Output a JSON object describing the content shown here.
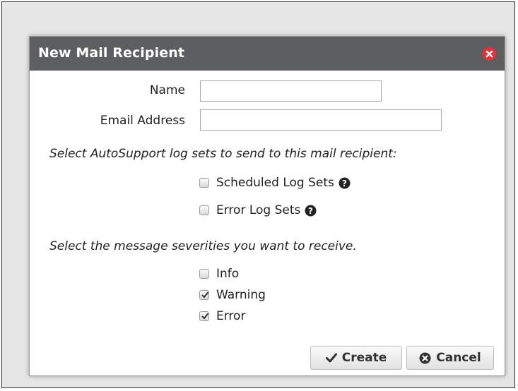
{
  "dialog": {
    "title": "New Mail Recipient",
    "close_icon": "close-icon"
  },
  "form": {
    "name_label": "Name",
    "name_value": "",
    "email_label": "Email Address",
    "email_value": ""
  },
  "log_sets": {
    "prompt": "Select AutoSupport log sets to send to this mail recipient:",
    "options": [
      {
        "label": "Scheduled Log Sets",
        "checked": false,
        "help_icon": "question-circle-icon"
      },
      {
        "label": "Error Log Sets",
        "checked": false,
        "help_icon": "question-circle-icon"
      }
    ]
  },
  "severities": {
    "prompt": "Select the message severities you want to receive.",
    "options": [
      {
        "label": "Info",
        "checked": false
      },
      {
        "label": "Warning",
        "checked": true
      },
      {
        "label": "Error",
        "checked": true
      }
    ]
  },
  "buttons": {
    "create_label": "Create",
    "create_icon": "check-icon",
    "cancel_label": "Cancel",
    "cancel_icon": "times-circle-icon"
  },
  "colors": {
    "titlebar": "#5d5e60",
    "close": "#e8303a"
  }
}
